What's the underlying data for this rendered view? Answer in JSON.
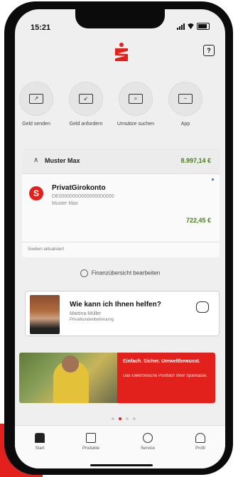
{
  "status_bar": {
    "time": "15:21"
  },
  "colors": {
    "brand": "#e2201c",
    "positive": "#4a7e1c"
  },
  "actions": [
    {
      "label": "Geld senden",
      "icon": "send-money-icon"
    },
    {
      "label": "Geld anfordern",
      "icon": "request-money-icon"
    },
    {
      "label": "Umsätze suchen",
      "icon": "search-transactions-icon"
    },
    {
      "label": "App",
      "icon": "app-icon"
    }
  ],
  "account_group": {
    "name": "Muster Max",
    "total": "8.997,14 €",
    "account": {
      "title": "PrivatGirokonto",
      "iban": "DE00000000000000000000",
      "owner": "Muster Max",
      "balance": "722,45 €"
    },
    "footer": "Soeben aktualisiert"
  },
  "finance_edit": "Finanzübersicht bearbeiten",
  "helper": {
    "question": "Wie kann ich Ihnen helfen?",
    "name": "Martina Müller",
    "role": "Privatkundenbetreuung"
  },
  "promo": {
    "headline": "Einfach. Sicher. Umweltbewusst.",
    "text": "Das Elektronische Postfach Ihrer Sparkasse."
  },
  "tabbar": [
    {
      "label": "Start",
      "icon": "home-icon"
    },
    {
      "label": "Produkte",
      "icon": "products-icon"
    },
    {
      "label": "Service",
      "icon": "service-icon"
    },
    {
      "label": "Profil",
      "icon": "profile-icon"
    }
  ]
}
